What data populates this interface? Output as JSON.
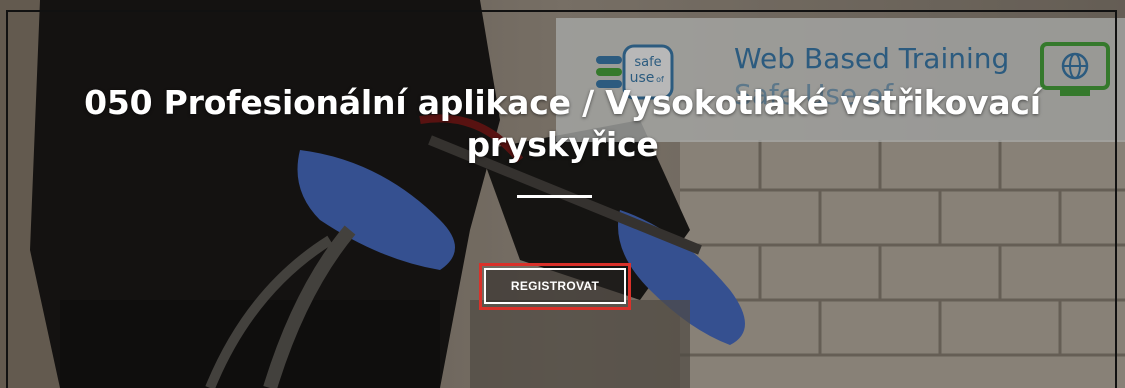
{
  "hero": {
    "title": "050 Profesionální aplikace / Vysokotlaké vstřikovací pryskyřice",
    "register_label": "REGISTROVAT"
  },
  "background_banner": {
    "logo_text_1": "safe",
    "logo_text_2": "use",
    "logo_text_3": "of",
    "line1": "Web Based Training",
    "line2": "Safe Use of",
    "icon": "globe-monitor-icon"
  },
  "colors": {
    "accent_highlight": "#d9312a",
    "banner_blue": "#3d7fb0",
    "logo_green": "#4aa83d"
  }
}
